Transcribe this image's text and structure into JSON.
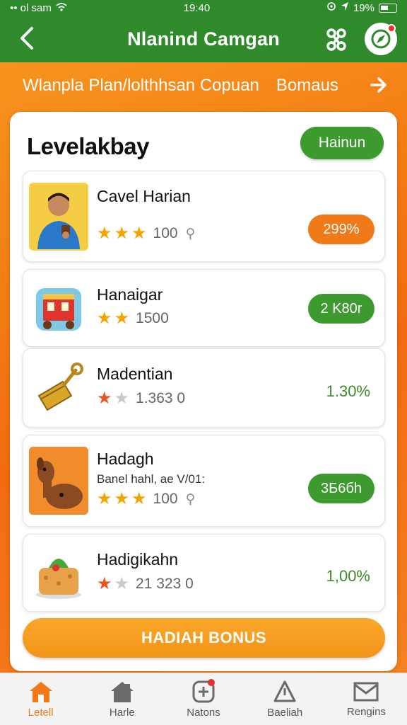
{
  "status_bar": {
    "carrier": "•• ol sam",
    "time": "19:40",
    "battery": "19%"
  },
  "header": {
    "title": "Nlanind Camgan",
    "back_icon": "chevron-left-icon",
    "action_icon_1": "network-icon",
    "action_icon_2": "compass-icon"
  },
  "banner": {
    "text": "Wlanpla Plan/lolthhsan Copuan",
    "bonus": "Bomaus"
  },
  "card": {
    "title": "Levelakbay",
    "button": "Hainun"
  },
  "items": [
    {
      "name": "Cavel Harian",
      "sub": "",
      "stars_on": 3,
      "rating": "100",
      "value": "299%",
      "value_style": "orange",
      "thumb": "boy"
    },
    {
      "name": "Hanaigar",
      "sub": "",
      "stars_on": 2,
      "rating": "1500",
      "value": "2 K80r",
      "value_style": "green",
      "thumb": "shop"
    },
    {
      "name": "Madentian",
      "sub": "",
      "stars_on": 1,
      "rating": "1.363  0",
      "value": "1.30%",
      "value_style": "plain",
      "thumb": "shovel"
    },
    {
      "name": "Hadagh",
      "sub": "Banel hahl, ae V/01:",
      "stars_on": 3,
      "rating": "100",
      "value": "3Б6бh",
      "value_style": "green",
      "thumb": "dog"
    },
    {
      "name": "Hadigikahn",
      "sub": "",
      "stars_on": 1,
      "rating": "21 323  0",
      "value": "1,00%",
      "value_style": "plain",
      "thumb": "cake"
    }
  ],
  "bonus_button": "HADIAH BONUS",
  "nav": [
    {
      "label": "Letell",
      "icon": "home-icon"
    },
    {
      "label": "Harle",
      "icon": "house-icon"
    },
    {
      "label": "Natons",
      "icon": "plus-box-icon"
    },
    {
      "label": "Baeliah",
      "icon": "triangle-icon"
    },
    {
      "label": "Rengins",
      "icon": "mail-icon"
    }
  ],
  "colors": {
    "header_green": "#2f8a2c",
    "accent_orange": "#f07a18",
    "pill_green": "#3c9a2f",
    "star_gold": "#f5a300"
  }
}
